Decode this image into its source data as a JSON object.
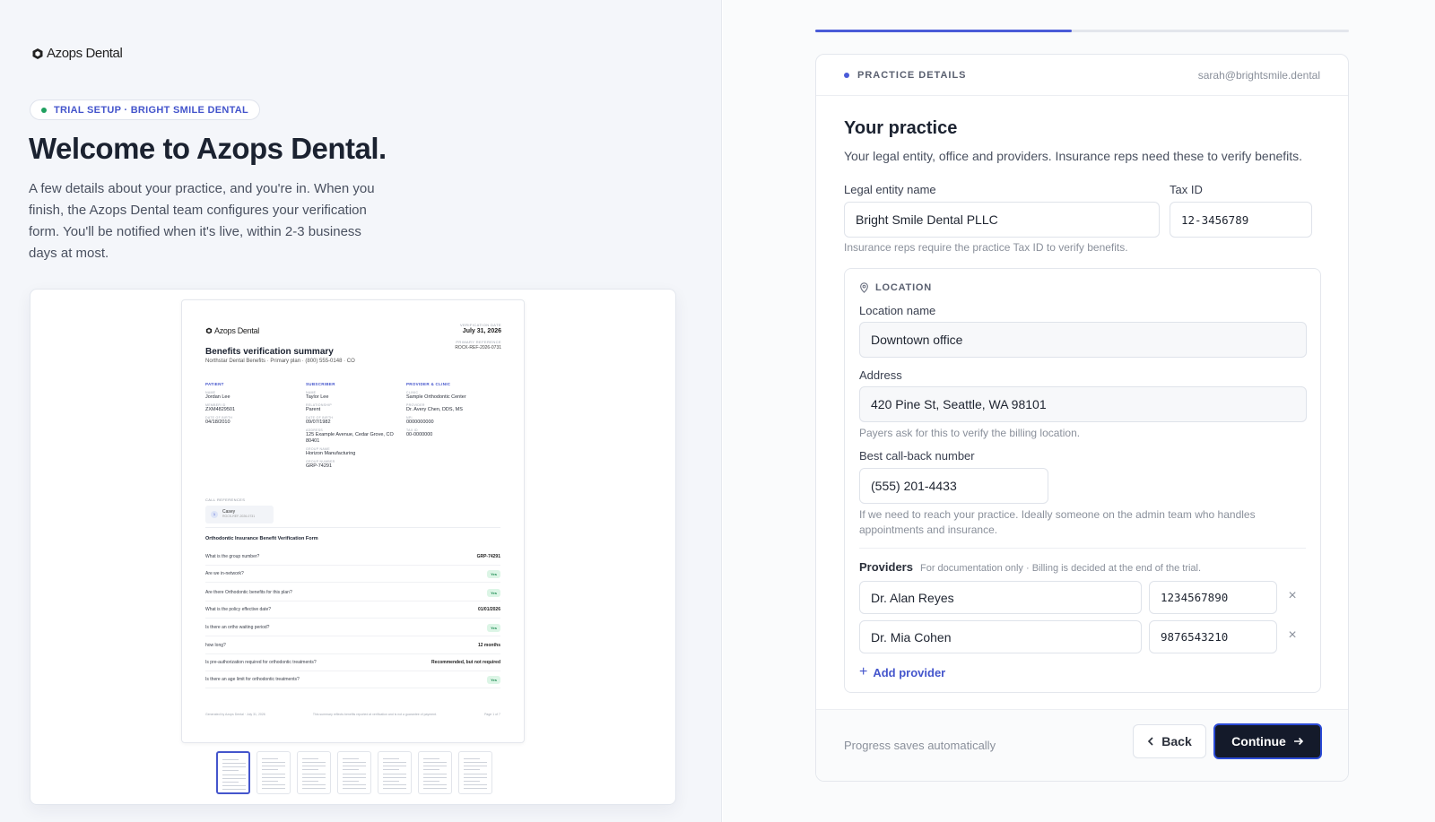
{
  "brand": {
    "name": "Azops Dental"
  },
  "hero": {
    "badge": "TRIAL SETUP · BRIGHT SMILE DENTAL",
    "title": "Welcome to Azops Dental.",
    "description": "A few details about your practice, and you're in. When you finish, the Azops Dental team configures your verification form. You'll be notified when it's live, within 2-3 business days at most."
  },
  "preview": {
    "brand": "Azops Dental",
    "verification_date_label": "VERIFICATION DATE",
    "verification_date": "July 31, 2026",
    "primary_reference_label": "PRIMARY REFERENCE",
    "primary_reference": "ROCK-REF-2026-0731",
    "title": "Benefits verification summary",
    "subtitle": "Northstar Dental Benefits · Primary plan · (800) 555-0148 · CO",
    "patient": {
      "heading": "PATIENT",
      "name_label": "NAME",
      "name": "Jordan Lee",
      "member_label": "MEMBER ID",
      "member": "ZXM4829501",
      "dob_label": "DATE OF BIRTH",
      "dob": "04/18/2010"
    },
    "subscriber": {
      "heading": "SUBSCRIBER",
      "name_label": "NAME",
      "name": "Taylor Lee",
      "rel_label": "RELATIONSHIP",
      "rel": "Parent",
      "dob_label": "DATE OF BIRTH",
      "dob": "09/07/1982",
      "addr_label": "ADDRESS",
      "addr": "125 Example Avenue, Cedar Grove, CO 80401",
      "group_label": "GROUP NAME",
      "group": "Horizon Manufacturing",
      "gnum_label": "GROUP NUMBER",
      "gnum": "GRP-74291"
    },
    "provider": {
      "heading": "PROVIDER & CLINIC",
      "clinic_label": "CLINIC",
      "clinic": "Sample Orthodontic Center",
      "prov_label": "PROVIDER",
      "prov": "Dr. Avery Chen, DDS, MS",
      "npi_label": "NPI",
      "npi": "0000000000",
      "tax_label": "TAX ID",
      "tax": "00-0000000"
    },
    "call_refs_label": "CALL REFERENCES",
    "call_ref": {
      "num": "1",
      "name": "Casey",
      "ref": "ROCK-REF-2026-0731"
    },
    "form_title": "Orthodontic Insurance Benefit Verification Form",
    "qa": [
      {
        "q": "What is the group number?",
        "a": "GRP-74291",
        "yes": false
      },
      {
        "q": "Are we in-network?",
        "a": "Yes",
        "yes": true
      },
      {
        "q": "Are there Orthodontic benefits for this plan?",
        "a": "Yes",
        "yes": true
      },
      {
        "q": "What is the policy effective date?",
        "a": "01/01/2026",
        "yes": false
      },
      {
        "q": "Is there an ortho waiting period?",
        "a": "Yes",
        "yes": true
      },
      {
        "q": "how long?",
        "a": "12 months",
        "yes": false
      },
      {
        "q": "Is pre-authorization required for orthodontic treatments?",
        "a": "Recommended, but not required",
        "yes": false
      },
      {
        "q": "Is there an age limit for orthodontic treatments?",
        "a": "Yes",
        "yes": true
      }
    ],
    "footer_left": "Generated by Azops Dental · July 31, 2026",
    "footer_mid": "This summary reflects benefits reported at verification and is not a guarantee of payment.",
    "footer_right": "Page 1 of 7",
    "page_count": 7,
    "active_page": 1
  },
  "wizard": {
    "progress": 0.48,
    "step_label": "PRACTICE DETAILS",
    "user_email": "sarah@brightsmile.dental",
    "section_title": "Your practice",
    "section_description": "Your legal entity, office and providers. Insurance reps need these to verify benefits.",
    "legal_entity_label": "Legal entity name",
    "legal_entity_value": "Bright Smile Dental PLLC",
    "tax_id_label": "Tax ID",
    "tax_id_value": "12-3456789",
    "tax_hint": "Insurance reps require the practice Tax ID to verify benefits.",
    "location": {
      "heading": "LOCATION",
      "name_label": "Location name",
      "name_value": "Downtown office",
      "address_label": "Address",
      "address_value": "420 Pine St, Seattle, WA 98101",
      "address_hint": "Payers ask for this to verify the billing location.",
      "phone_label": "Best call-back number",
      "phone_value": "(555) 201-4433",
      "phone_hint": "If we need to reach your practice. Ideally someone on the admin team who handles appointments and insurance."
    },
    "providers": {
      "title": "Providers",
      "subtitle": "For documentation only · Billing is decided at the end of the trial.",
      "items": [
        {
          "name": "Dr. Alan Reyes",
          "npi": "1234567890"
        },
        {
          "name": "Dr. Mia Cohen",
          "npi": "9876543210"
        }
      ],
      "add_label": "Add provider"
    },
    "footer": {
      "save_note": "Progress saves automatically",
      "back_label": "Back",
      "continue_label": "Continue"
    }
  },
  "colors": {
    "accent": "#4a5bd8",
    "primary_button": "#141a2a",
    "success": "#1fa05f"
  }
}
